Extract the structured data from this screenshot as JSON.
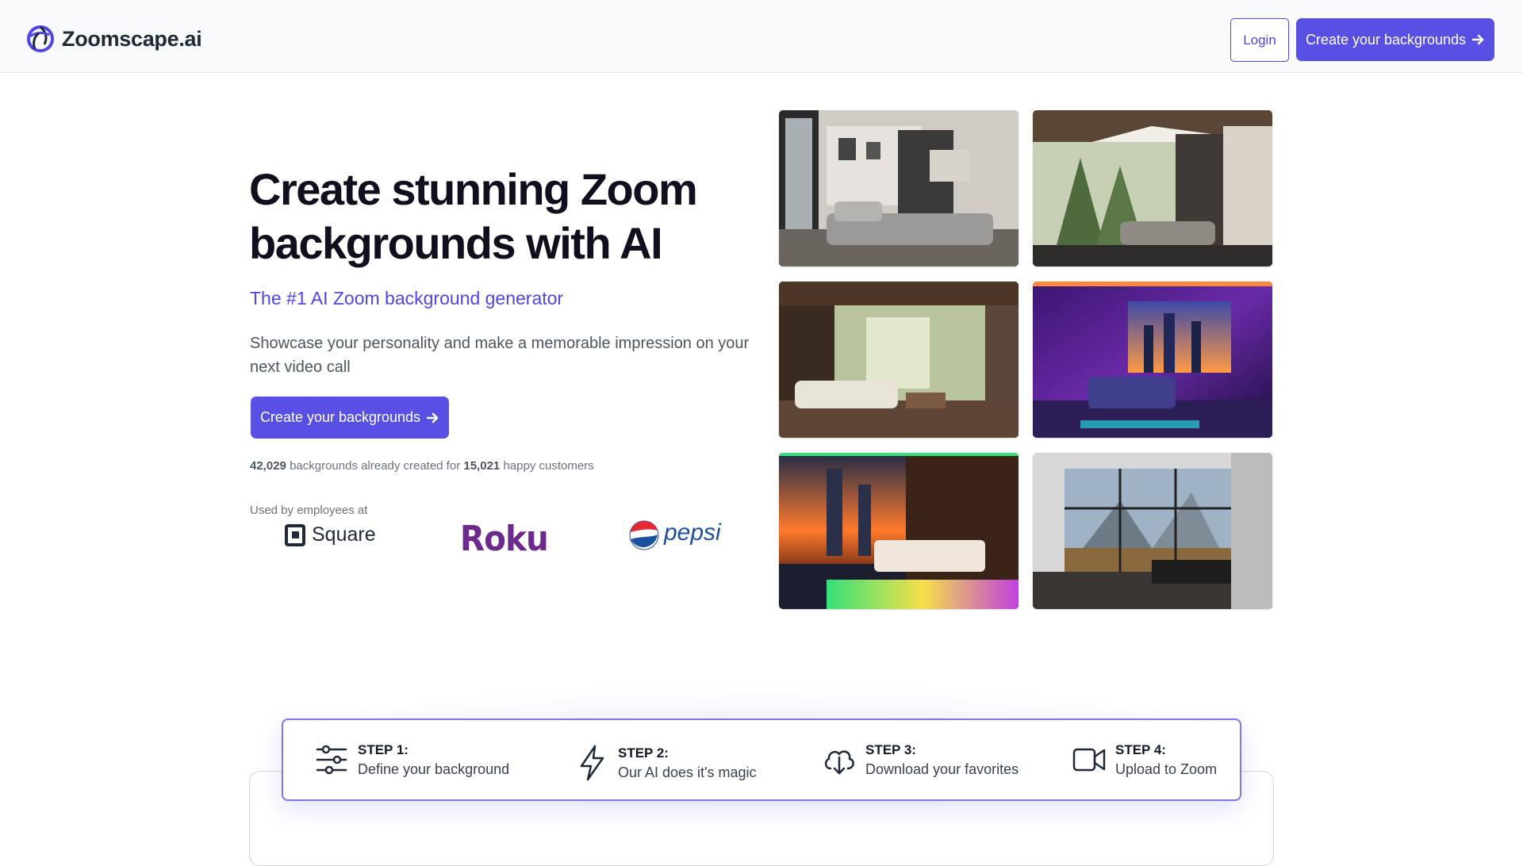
{
  "header": {
    "brand": "Zoomscape.ai",
    "login_label": "Login",
    "cta_label": "Create your backgrounds"
  },
  "hero": {
    "title_line1": "Create stunning Zoom",
    "title_line2": "backgrounds with AI",
    "subtitle": "The #1 AI Zoom background generator",
    "description": "Showcase your personality and make a memorable impression on your next video call",
    "cta_label": "Create your backgrounds",
    "stats": {
      "backgrounds_count": "42,029",
      "backgrounds_text": "backgrounds already created for",
      "customers_count": "15,021",
      "customers_text": "happy customers"
    },
    "used_by_label": "Used by employees at",
    "logos": {
      "square": "Square",
      "roku": "Roku",
      "pepsi": "pepsi"
    }
  },
  "gallery": {
    "tiles": [
      {
        "alt": "Modern monochrome living room with floor-to-ceiling windows",
        "palette": [
          "#d9d6d0",
          "#3a3a3a",
          "#9a9a98"
        ]
      },
      {
        "alt": "Glass A-frame living room overlooking a forest",
        "palette": [
          "#e8e6de",
          "#6d7a5c",
          "#3c3a36"
        ]
      },
      {
        "alt": "Wood-paneled living room opening onto a jungle",
        "palette": [
          "#3b2a20",
          "#b9c3a2",
          "#f1ece0"
        ]
      },
      {
        "alt": "Neon-lit bedroom with purple walls and city view",
        "palette": [
          "#4c1d7a",
          "#ff8a3a",
          "#2ad1d9"
        ]
      },
      {
        "alt": "Neon-accented bedroom with city sunset and rainbow floor",
        "palette": [
          "#1f2a46",
          "#ff7a2d",
          "#35e07a"
        ]
      },
      {
        "alt": "Minimal room with large windows overlooking mountains",
        "palette": [
          "#c8cdd0",
          "#7a8c99",
          "#2e2e2e"
        ]
      }
    ]
  },
  "steps": [
    {
      "title": "STEP 1:",
      "desc": "Define your background",
      "icon": "sliders-icon"
    },
    {
      "title": "STEP 2:",
      "desc": "Our AI does it's magic",
      "icon": "lightning-icon"
    },
    {
      "title": "STEP 3:",
      "desc": "Download your favorites",
      "icon": "cloud-download-icon"
    },
    {
      "title": "STEP 4:",
      "desc": "Upload to Zoom",
      "icon": "video-camera-icon"
    }
  ],
  "colors": {
    "accent": "#5750e3",
    "subtitle": "#4f46e5",
    "roku": "#6c2a8c",
    "pepsi": "#1d4fa0"
  }
}
